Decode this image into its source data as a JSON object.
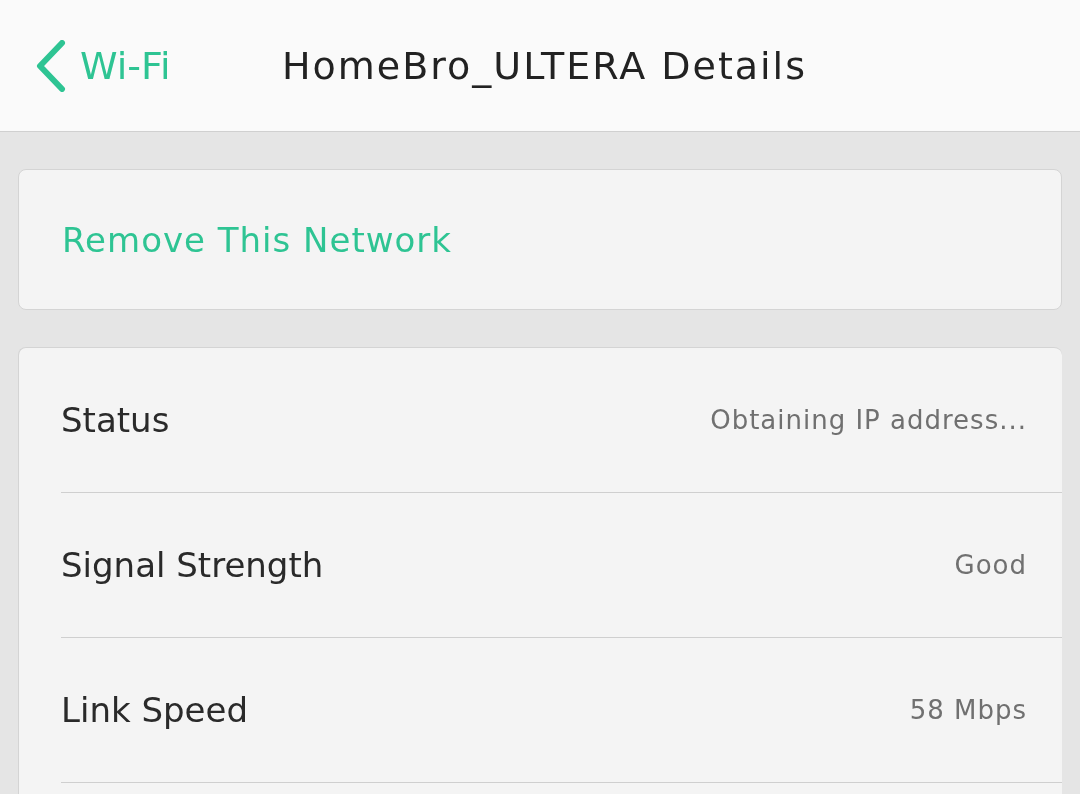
{
  "header": {
    "back_label": "Wi-Fi",
    "title": "HomeBro_ULTERA Details"
  },
  "actions": [
    {
      "label": "Remove This Network"
    }
  ],
  "details": [
    {
      "label": "Status",
      "value": "Obtaining IP address..."
    },
    {
      "label": "Signal Strength",
      "value": "Good"
    },
    {
      "label": "Link Speed",
      "value": "58 Mbps"
    }
  ]
}
